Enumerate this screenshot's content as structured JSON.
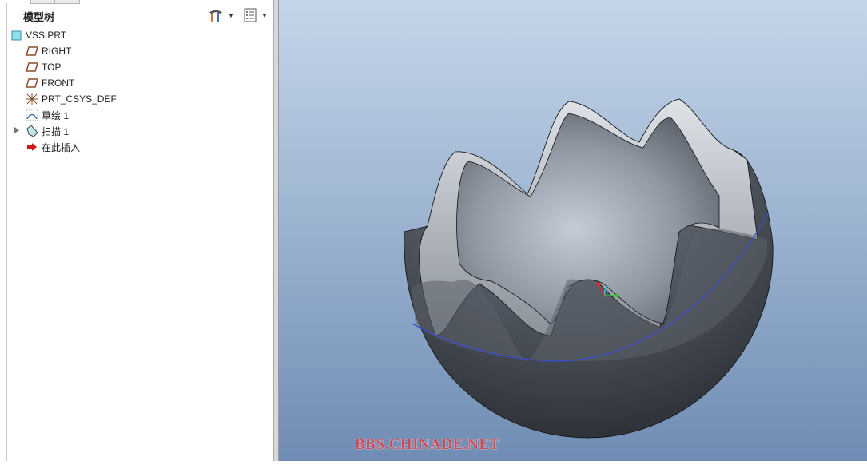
{
  "model_tree": {
    "title": "模型树",
    "settings_icon": "tree-tools-icon",
    "columns_icon": "tree-columns-icon",
    "items": [
      {
        "label": "VSS.PRT",
        "icon": "part-icon"
      },
      {
        "label": "RIGHT",
        "icon": "datum-plane-icon"
      },
      {
        "label": "TOP",
        "icon": "datum-plane-icon"
      },
      {
        "label": "FRONT",
        "icon": "datum-plane-icon"
      },
      {
        "label": "PRT_CSYS_DEF",
        "icon": "csys-icon"
      },
      {
        "label": "草绘 1",
        "icon": "sketch-icon"
      },
      {
        "label": "扫描 1",
        "icon": "sweep-icon"
      },
      {
        "label": "在此插入",
        "icon": "insert-here-arrow-icon"
      }
    ]
  },
  "viewport": {
    "watermark": "BBS.CHINADE.NET",
    "colors": {
      "bg_top": "#c4d5e8",
      "bg_bottom": "#6f8cb4",
      "edge_blue": "#3a4fd0"
    }
  }
}
